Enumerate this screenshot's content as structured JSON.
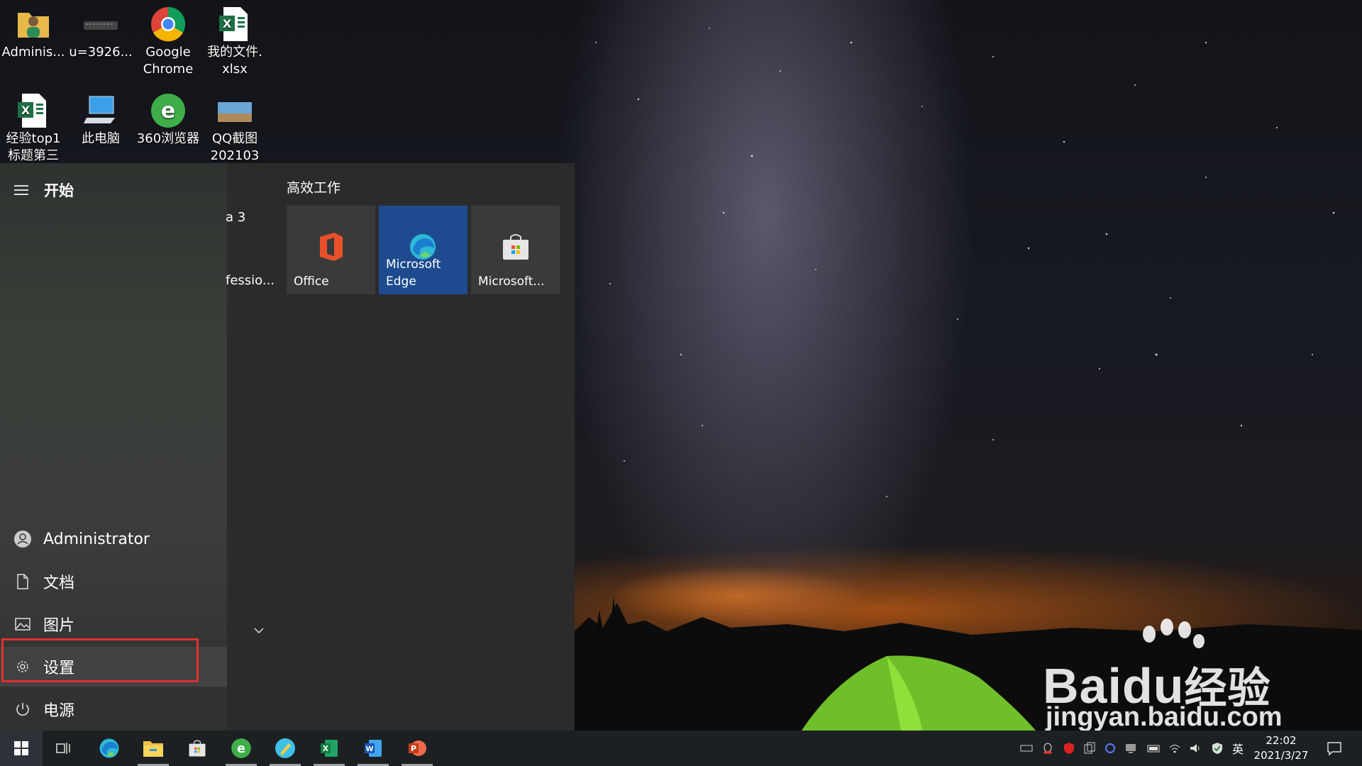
{
  "desktop": {
    "icons": [
      {
        "label": "Adminis...",
        "icon": "user-folder-icon"
      },
      {
        "label": "u=3926...",
        "icon": "image-file-icon"
      },
      {
        "label": "Google\nChrome",
        "icon": "chrome-icon"
      },
      {
        "label": "我的文件.\nxlsx",
        "icon": "excel-file-icon"
      },
      {
        "label": "经验top1\n标题第三",
        "icon": "excel-file-icon"
      },
      {
        "label": "此电脑",
        "icon": "computer-icon"
      },
      {
        "label": "360浏览器",
        "icon": "360-browser-icon"
      },
      {
        "label": "QQ截图\n202103",
        "icon": "screenshot-image-icon"
      }
    ]
  },
  "start_menu": {
    "title": "开始",
    "left_items": [
      {
        "label": "Administrator",
        "icon": "user-avatar-icon"
      },
      {
        "label": "文档",
        "icon": "document-icon"
      },
      {
        "label": "图片",
        "icon": "pictures-icon"
      },
      {
        "label": "设置",
        "icon": "gear-icon",
        "highlighted": true
      },
      {
        "label": "电源",
        "icon": "power-icon"
      }
    ],
    "app_list_fragments": [
      "a 3",
      "fessio..."
    ],
    "tile_group": {
      "title": "高效工作",
      "tiles": [
        {
          "label": "Office",
          "icon": "office-icon",
          "color": "#3a3a3a"
        },
        {
          "label": "Microsoft\nEdge",
          "icon": "edge-icon",
          "color": "#1e4b8f"
        },
        {
          "label": "Microsoft...",
          "icon": "store-icon",
          "color": "#3a3a3a"
        }
      ]
    }
  },
  "taskbar": {
    "pinned": [
      {
        "name": "start",
        "icon": "windows-icon"
      },
      {
        "name": "task-view",
        "icon": "task-view-icon"
      },
      {
        "name": "edge",
        "icon": "edge-icon"
      },
      {
        "name": "file-explorer",
        "icon": "folder-icon"
      },
      {
        "name": "store",
        "icon": "store-icon"
      },
      {
        "name": "360-browser",
        "icon": "360-browser-icon"
      },
      {
        "name": "notes-app",
        "icon": "pencil-app-icon"
      },
      {
        "name": "excel",
        "icon": "excel-icon"
      },
      {
        "name": "word",
        "icon": "word-icon"
      },
      {
        "name": "powerpoint",
        "icon": "powerpoint-icon"
      }
    ],
    "ime": "英",
    "time": "22:02",
    "date": "2021/3/27"
  },
  "watermark": {
    "brand": "Bai",
    "brand2": "du",
    "cn": "经验",
    "url": "jingyan.baidu.com"
  },
  "colors": {
    "accent_edge_tile": "#1e4b8f",
    "highlight_border": "#e03030",
    "taskbar": "#1c2023"
  }
}
